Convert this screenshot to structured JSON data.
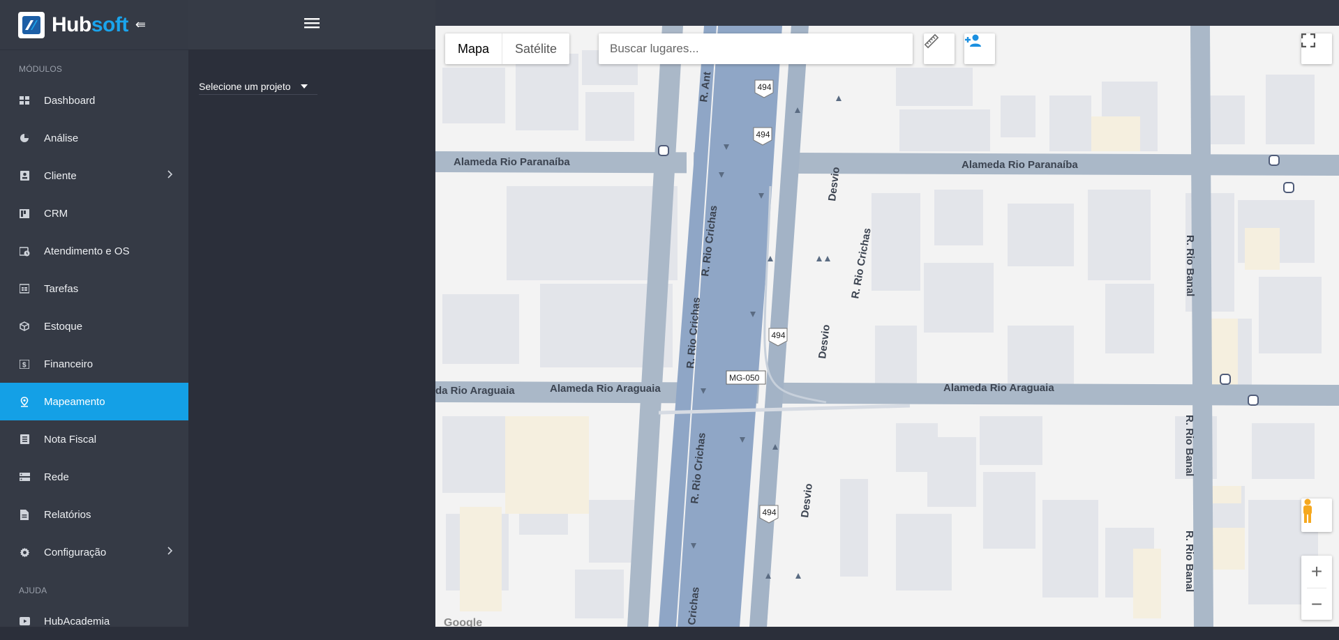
{
  "brand": {
    "name_part1": "Hub",
    "name_part2": "soft",
    "accent_color": "#1aa4ec"
  },
  "sidebar": {
    "section_modules": "MÓDULOS",
    "section_help": "AJUDA",
    "items": [
      {
        "label": "Dashboard",
        "icon": "dashboard-icon"
      },
      {
        "label": "Análise",
        "icon": "pie-chart-icon"
      },
      {
        "label": "Cliente",
        "icon": "contact-card-icon",
        "has_submenu": true
      },
      {
        "label": "CRM",
        "icon": "kanban-icon"
      },
      {
        "label": "Atendimento e OS",
        "icon": "calendar-clock-icon"
      },
      {
        "label": "Tarefas",
        "icon": "task-board-icon"
      },
      {
        "label": "Estoque",
        "icon": "box-icon"
      },
      {
        "label": "Financeiro",
        "icon": "money-icon"
      },
      {
        "label": "Mapeamento",
        "icon": "map-pin-icon",
        "active": true
      },
      {
        "label": "Nota Fiscal",
        "icon": "document-list-icon"
      },
      {
        "label": "Rede",
        "icon": "network-icon"
      },
      {
        "label": "Relatórios",
        "icon": "report-icon"
      },
      {
        "label": "Configuração",
        "icon": "gear-icon",
        "has_submenu": true
      }
    ],
    "help_items": [
      {
        "label": "HubAcademia",
        "icon": "video-icon"
      }
    ]
  },
  "panel": {
    "project_select_label": "Selecione um projeto"
  },
  "map": {
    "map_type_options": [
      "Mapa",
      "Satélite"
    ],
    "selected_map_type": "Mapa",
    "search_placeholder": "Buscar lugares...",
    "google_watermark": "Google",
    "street_labels": {
      "paranaiba_left": "Alameda Rio Paranaíba",
      "paranaiba_right": "Alameda Rio Paranaíba",
      "araguaia_cut": "da Rio Araguaia",
      "araguaia_mid": "Alameda Rio Araguaia",
      "araguaia_right": "Alameda Rio Araguaia",
      "crichas_1": "R. Rio Crichas",
      "crichas_2": "R. Rio Crichas",
      "crichas_3": "R. Rio Crichas",
      "crichas_4": "R. Rio Crichas",
      "crichas_5": "Crichas",
      "antonio": "R. Ant",
      "desvio_1": "Desvio",
      "desvio_2": "Desvio",
      "desvio_3": "Desvio",
      "banal_1": "R. Rio Banal",
      "banal_2": "R. Rio Banal",
      "banal_3": "R. Rio Banal"
    },
    "route_shields": [
      "494",
      "494",
      "494",
      "494"
    ],
    "state_route": "MG-050",
    "colors": {
      "road": "#a8b6c6",
      "highway": "#8ea6c4",
      "background": "#f3f3f3",
      "building": "#e4e6ea"
    }
  }
}
